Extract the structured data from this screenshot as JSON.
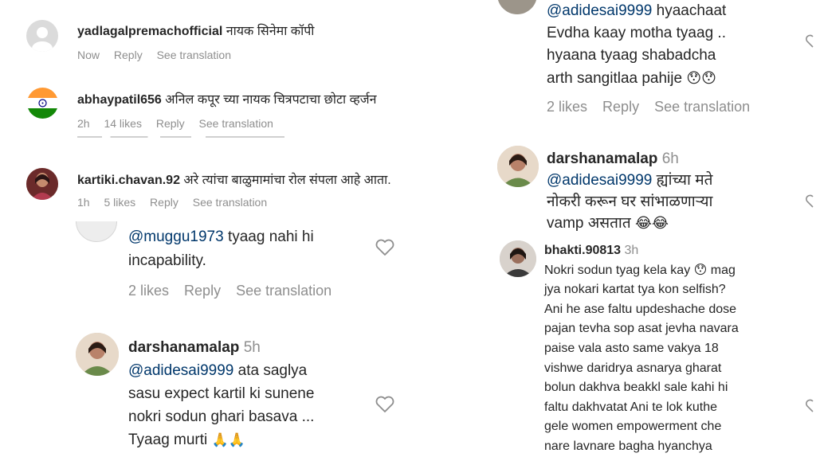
{
  "colors": {
    "text": "#262626",
    "muted": "#8e8e8e",
    "mention": "#00376b",
    "background": "#ffffff"
  },
  "left": {
    "c1": {
      "username": "yadlagalpremachofficial",
      "text": "नायक सिनेमा कॉपी",
      "time": "Now",
      "reply": "Reply",
      "translate": "See translation"
    },
    "c2": {
      "username": "abhaypatil656",
      "text": "अनिल कपूर च्या नायक चित्रपटाचा छोटा व्हर्जन",
      "time": "2h",
      "likes": "14 likes",
      "reply": "Reply",
      "translate": "See translation",
      "avatar_icon": "india-flag-icon"
    },
    "c3": {
      "username": "kartiki.chavan.92",
      "text": "अरे त्यांचा बाळुमामांचा रोल संपला आहे आता.",
      "time": "1h",
      "likes": "5 likes",
      "reply": "Reply",
      "translate": "See translation"
    },
    "c4": {
      "mention": "@muggu1973",
      "line1": "tyaag nahi hi",
      "line2": "incapability.",
      "likes": "2 likes",
      "reply": "Reply",
      "translate": "See translation"
    },
    "c5": {
      "username": "darshanamalap",
      "time": "5h",
      "mention": "@adidesai9999",
      "line1": "ata saglya",
      "line2": "sasu expect kartil ki sunene",
      "line3": "nokri sodun ghari basava ...",
      "line4": "Tyaag murti",
      "emojis": "🙏🙏"
    }
  },
  "right": {
    "c1": {
      "mention": "@adidesai9999",
      "line1": "hyaachaat",
      "line2": "Evdha kaay motha tyaag ..",
      "line3": "hyaana tyaag shabadcha",
      "line4": "arth sangitlaa pahije",
      "emojis": "😯😯",
      "likes": "2 likes",
      "reply": "Reply",
      "translate": "See translation"
    },
    "c2": {
      "username": "darshanamalap",
      "time": "6h",
      "mention": "@adidesai9999",
      "line1": "ह्यांच्या मते",
      "line2": "नोकरी करून घर सांभाळणाऱ्या",
      "line3": "vamp असतात",
      "emojis": "😂😂"
    },
    "c3": {
      "username": "bhakti.90813",
      "time": "3h",
      "lines": [
        "Nokri sodun tyag kela kay",
        "jya nokari kartat tya kon selfish?",
        "Ani he ase faltu updeshache dose",
        "pajan tevha sop asat jevha navara",
        "paise vala asto same vakya 18",
        "vishwe daridrya asnarya gharat",
        "bolun dakhva beakkl sale kahi hi",
        "faltu dakhvatat Ani te lok kuthe",
        "gele women empowerment che",
        "nare lavnare bagha hyanchya"
      ],
      "line1_suffix": "mag",
      "emoji_inline": "😯"
    }
  }
}
